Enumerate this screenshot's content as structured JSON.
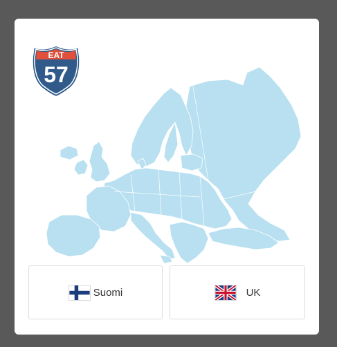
{
  "logo": {
    "top_text": "EAT",
    "number": "57",
    "colors": {
      "shield": "#2f5a8a",
      "banner": "#e0503a",
      "outline": "#ffffff"
    }
  },
  "map": {
    "icon": "europe-map-icon",
    "land_color": "#b8e0f0",
    "border_color": "#ffffff"
  },
  "languages": [
    {
      "label": "Suomi",
      "flag": "finland-flag-icon"
    },
    {
      "label": "UK",
      "flag": "uk-flag-icon"
    }
  ]
}
